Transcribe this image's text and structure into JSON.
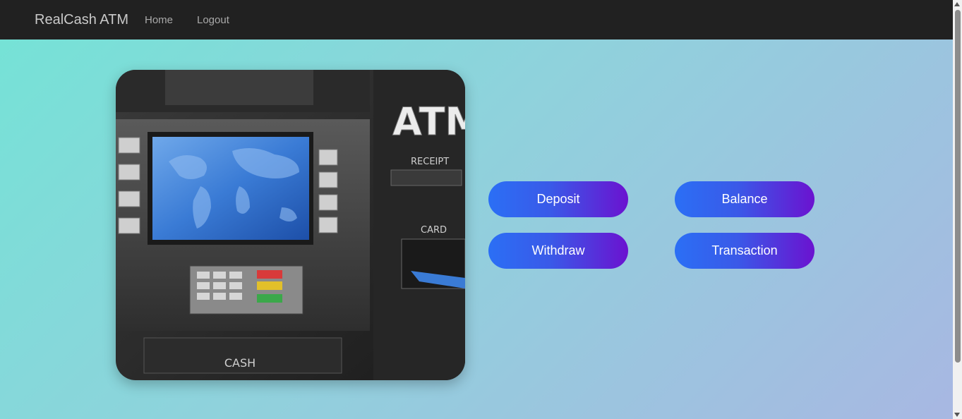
{
  "navbar": {
    "brand": "RealCash ATM",
    "links": [
      {
        "label": "Home"
      },
      {
        "label": "Logout"
      }
    ]
  },
  "atm_image": {
    "sign": "ATM",
    "receipt_label": "RECEIPT",
    "card_label": "CARD",
    "cash_label": "CASH"
  },
  "actions": {
    "deposit": "Deposit",
    "balance": "Balance",
    "withdraw": "Withdraw",
    "transaction": "Transaction"
  },
  "colors": {
    "navbar_bg": "#212121",
    "button_gradient_start": "#2b6ff5",
    "button_gradient_end": "#6b12d0",
    "page_gradient_start": "#74e3d6",
    "page_gradient_end": "#a8b7e2"
  }
}
